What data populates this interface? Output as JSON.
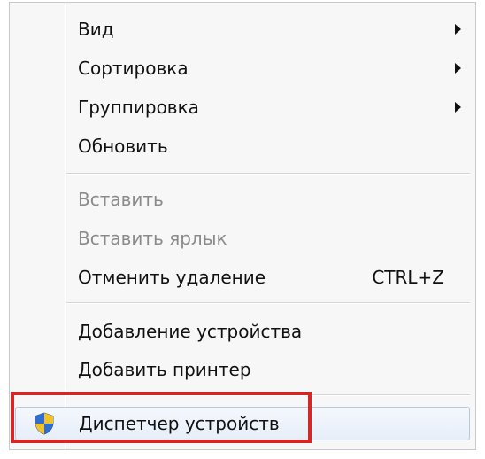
{
  "context_menu": {
    "items": [
      {
        "label": "Вид",
        "has_submenu": true
      },
      {
        "label": "Сортировка",
        "has_submenu": true
      },
      {
        "label": "Группировка",
        "has_submenu": true
      },
      {
        "label": "Обновить"
      },
      {
        "label": "Вставить",
        "enabled": false
      },
      {
        "label": "Вставить ярлык",
        "enabled": false
      },
      {
        "label": "Отменить удаление",
        "shortcut": "CTRL+Z"
      },
      {
        "label": "Добавление устройства"
      },
      {
        "label": "Добавить принтер"
      },
      {
        "label": "Диспетчер устройств",
        "icon": "uac-shield-icon",
        "highlighted": true
      }
    ]
  },
  "annotation": {
    "color": "#d42727",
    "target": "Диспетчер устройств"
  },
  "colors": {
    "menu_background": "#f7f7f7",
    "disabled_text": "#8b8b8b",
    "highlight_border": "#b5c8de"
  }
}
